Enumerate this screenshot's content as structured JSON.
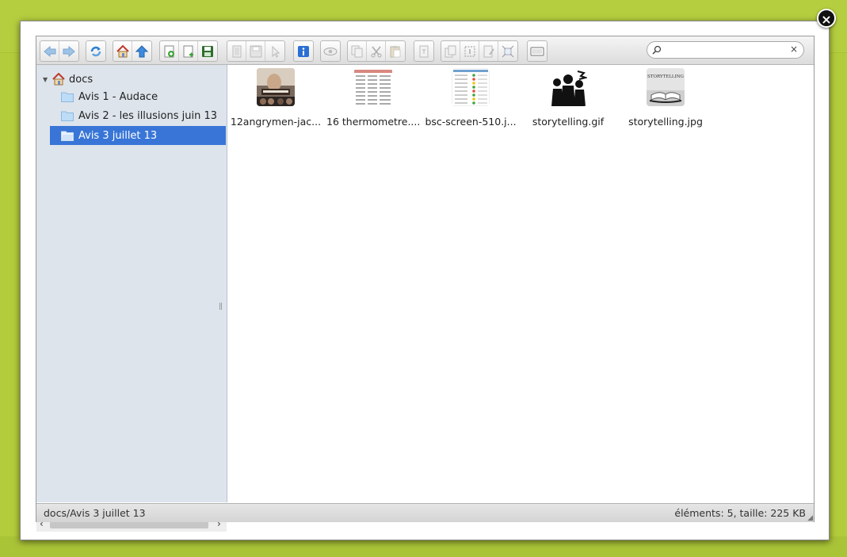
{
  "window": {
    "close_label": "×"
  },
  "toolbar": {
    "groups": [
      [
        "back-icon",
        "forward-icon"
      ],
      [
        "reload-icon"
      ],
      [
        "home-icon",
        "up-icon"
      ],
      [
        "new-folder-icon",
        "new-file-icon",
        "save-icon"
      ],
      [
        "open-icon",
        "save-disabled-icon",
        "select-icon"
      ],
      [
        "info-icon"
      ],
      [
        "view-icon"
      ],
      [
        "copy-icon",
        "cut-icon",
        "paste-icon"
      ],
      [
        "rename-icon"
      ],
      [
        "duplicate-icon",
        "select-all-icon",
        "edit-icon",
        "resize-icon"
      ],
      [
        "view-mode-icon"
      ]
    ],
    "colors": {
      "active_blue": "#2a7fd4",
      "active_green": "#3fa43c",
      "disabled": "#b8b8b8"
    }
  },
  "search": {
    "placeholder": "",
    "value": "",
    "clear_label": "×"
  },
  "tree": {
    "root_label": "docs",
    "items": [
      {
        "label": "Avis 1 - Audace",
        "selected": false
      },
      {
        "label": "Avis 2 - les illusions juin 13",
        "selected": false
      },
      {
        "label": "Avis 3 juillet 13",
        "selected": true
      }
    ],
    "selected_color": "#3875d7"
  },
  "files": [
    {
      "name": "12angrymen-jac...",
      "thumb": "movie-poster"
    },
    {
      "name": "16 thermometre....",
      "thumb": "spreadsheet"
    },
    {
      "name": "bsc-screen-510.j...",
      "thumb": "scorecard"
    },
    {
      "name": "storytelling.gif",
      "thumb": "silhouette"
    },
    {
      "name": "storytelling.jpg",
      "thumb": "book",
      "caption": "STORYTELLING"
    }
  ],
  "status": {
    "path": "docs/Avis 3 juillet 13",
    "stats": "éléments: 5, taille: 225 KB"
  }
}
